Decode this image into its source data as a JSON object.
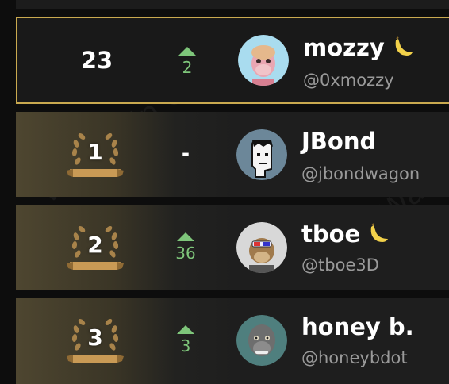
{
  "current_user": {
    "rank": "23",
    "change": "2",
    "change_direction": "up",
    "name": "mozzy",
    "handle": "@0xmozzy",
    "badge_icon": "banana-icon",
    "avatar": "bored-ape-pink-avatar"
  },
  "leaderboard": [
    {
      "rank": "1",
      "change": "-",
      "change_direction": "none",
      "name": "JBond",
      "handle": "@jbondwagon",
      "badge_icon": "",
      "avatar": "cryptopunk-avatar"
    },
    {
      "rank": "2",
      "change": "36",
      "change_direction": "up",
      "name": "tboe",
      "handle": "@tboe3D",
      "badge_icon": "banana-icon",
      "avatar": "bored-ape-3d-glasses-avatar"
    },
    {
      "rank": "3",
      "change": "3",
      "change_direction": "up",
      "name": "honey b.",
      "handle": "@honeybdot",
      "badge_icon": "",
      "avatar": "gorilla-avatar"
    }
  ],
  "watermark": "Wallchain Quacks",
  "colors": {
    "highlight_border": "#c9a94f",
    "up_green": "#7ec57a",
    "laurel_gold": "#b08a4a"
  }
}
